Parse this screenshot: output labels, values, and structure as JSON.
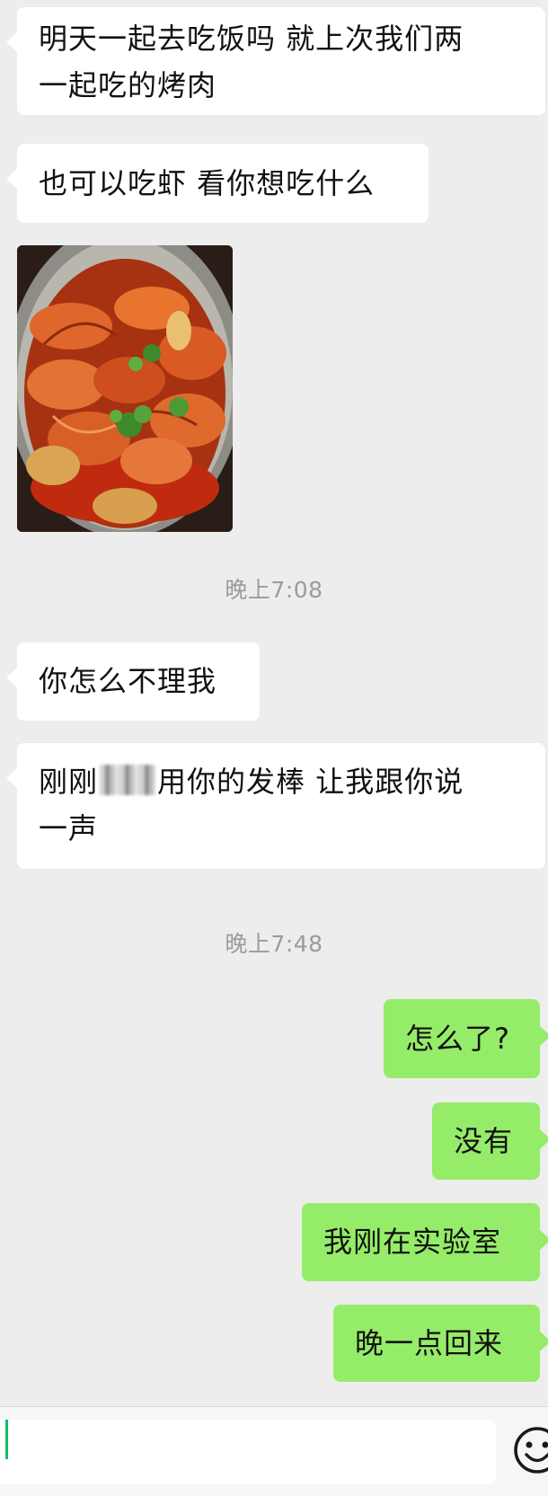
{
  "conversation": {
    "messages": [
      {
        "side": "in",
        "lines": [
          "明天一起去吃饭吗 就上次我们两",
          "一起吃的烤肉"
        ]
      },
      {
        "side": "in",
        "lines": [
          "也可以吃虾 看你想吃什么"
        ]
      },
      {
        "side": "in",
        "type": "image",
        "image_icon": "food-photo-icon"
      },
      {
        "type": "time",
        "text": "晚上7:08"
      },
      {
        "side": "in",
        "lines": [
          "你怎么不理我"
        ]
      },
      {
        "side": "in",
        "lines": [
          "刚刚",
          "用你的发棒 让我跟你说",
          "一声"
        ]
      },
      {
        "type": "time",
        "text": "晚上7:48"
      },
      {
        "side": "out",
        "lines": [
          "怎么了?"
        ]
      },
      {
        "side": "out",
        "lines": [
          "没有"
        ]
      },
      {
        "side": "out",
        "lines": [
          "我刚在实验室"
        ]
      },
      {
        "side": "out",
        "lines": [
          "晚一点回来"
        ]
      }
    ]
  },
  "input": {
    "value": "",
    "emoji_icon": "emoji-icon"
  },
  "colors": {
    "background": "#ededed",
    "incoming_bubble": "#ffffff",
    "outgoing_bubble": "#95ec69",
    "timestamp": "#9b9b9b",
    "cursor": "#07c160"
  }
}
